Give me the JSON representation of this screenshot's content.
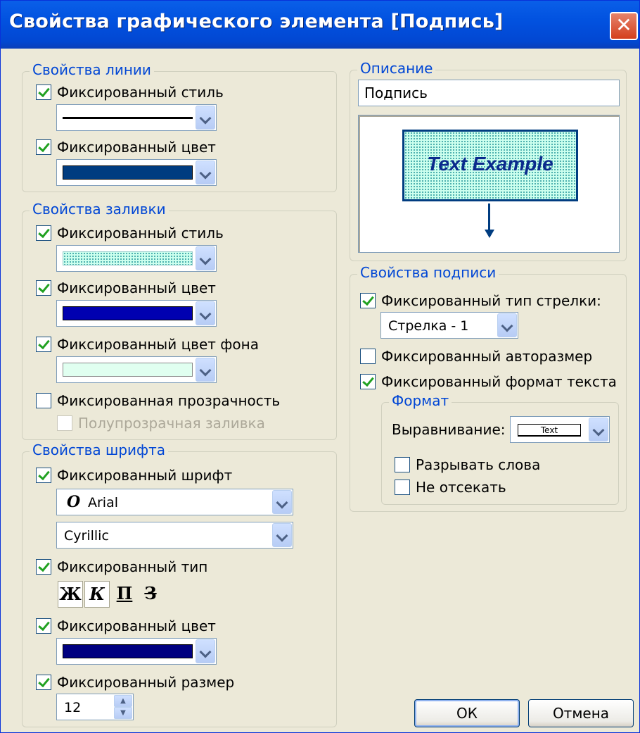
{
  "window": {
    "title": "Свойства графического элемента [Подпись]",
    "close": "✕"
  },
  "line": {
    "legend": "Свойства линии",
    "style_label": "Фиксированный стиль",
    "color_label": "Фиксированный цвет",
    "color": "#003c80"
  },
  "fill": {
    "legend": "Свойства заливки",
    "style_label": "Фиксированный стиль",
    "color_label": "Фиксированный цвет",
    "bg_label": "Фиксированный цвет фона",
    "transp_label": "Фиксированная прозрачность",
    "semi_label": "Полупрозрачная заливка",
    "color": "#0000b0",
    "bg_color": "#e0fff0"
  },
  "font": {
    "legend": "Свойства шрифта",
    "font_label": "Фиксированный шрифт",
    "font_name": "Arial",
    "font_glyph": "O",
    "script": "Cyrillic",
    "type_label": "Фиксированный тип",
    "bold": "Ж",
    "italic": "К",
    "underline": "П",
    "strike": "З",
    "color_label": "Фиксированный цвет",
    "color": "#000080",
    "size_label": "Фиксированный размер",
    "size": "12"
  },
  "desc": {
    "legend": "Описание",
    "value": "Подпись",
    "preview_text": "Text Example"
  },
  "caption": {
    "legend": "Свойства подписи",
    "arrow_label": "Фиксированный тип стрелки:",
    "arrow_value": "Стрелка - 1",
    "autosize_label": "Фиксированный авторазмер",
    "format_label": "Фиксированный формат текста"
  },
  "format": {
    "legend": "Формат",
    "align_label": "Выравнивание:",
    "align_sample": "Text",
    "wrap_label": "Разрывать слова",
    "noclip_label": "Не отсекать"
  },
  "buttons": {
    "ok": "ОК",
    "cancel": "Отмена"
  }
}
